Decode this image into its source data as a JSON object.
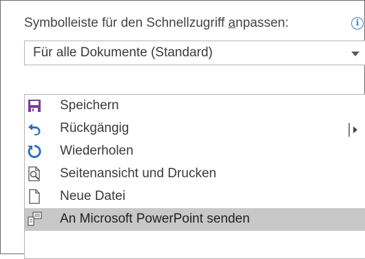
{
  "header": {
    "label_before": "Symbolleiste für den Schnellzugriff ",
    "label_accel": "a",
    "label_after": "npassen:"
  },
  "scope_dropdown": {
    "selected": "Für alle Dokumente (Standard)"
  },
  "commands": [
    {
      "label": "Speichern",
      "icon": "save-icon",
      "selected": false
    },
    {
      "label": "Rückgängig",
      "icon": "undo-icon",
      "selected": false,
      "has_submenu": true
    },
    {
      "label": "Wiederholen",
      "icon": "redo-icon",
      "selected": false
    },
    {
      "label": "Seitenansicht und Drucken",
      "icon": "print-preview-icon",
      "selected": false
    },
    {
      "label": "Neue Datei",
      "icon": "new-file-icon",
      "selected": false
    },
    {
      "label": "An Microsoft PowerPoint senden",
      "icon": "send-to-powerpoint-icon",
      "selected": true
    }
  ],
  "colors": {
    "icon_purple": "#7b3c9a",
    "icon_blue": "#2f6fbf",
    "selection": "#c8c8c8",
    "info_blue": "#3d7cc9"
  }
}
